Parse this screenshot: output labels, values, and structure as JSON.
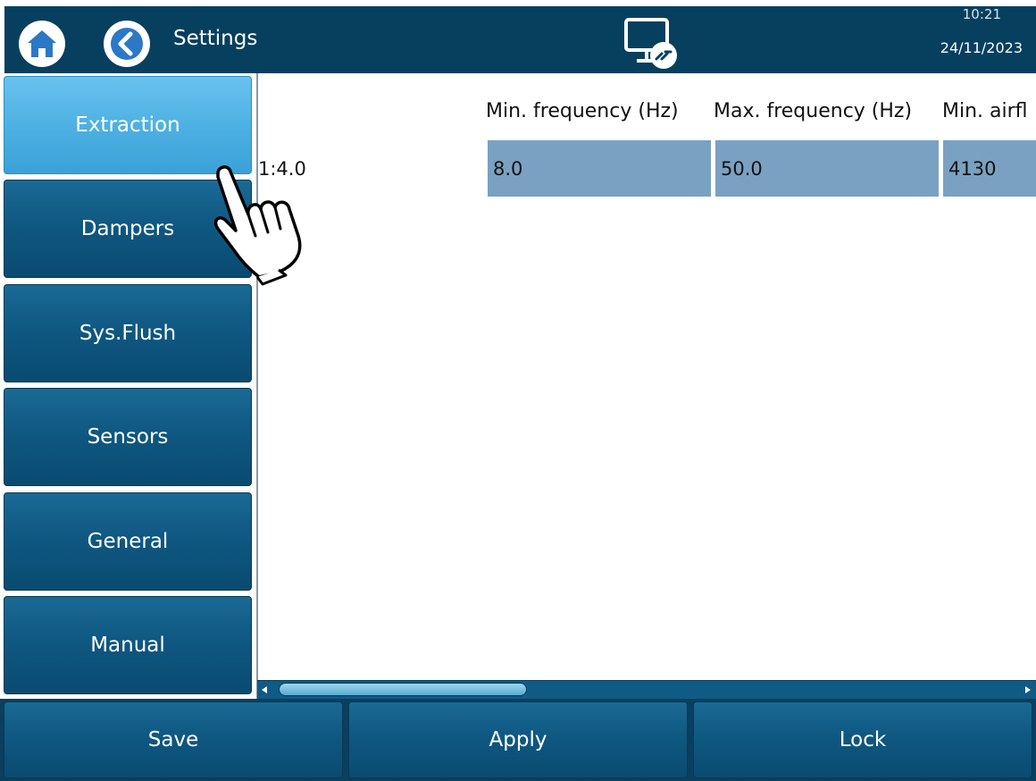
{
  "header": {
    "title": "Settings",
    "time": "10:21",
    "date": "24/11/2023",
    "home_icon": "home-icon",
    "back_icon": "chevron-left-icon",
    "remote_icon": "remote-desktop-icon"
  },
  "nav": {
    "items": [
      {
        "label": "Extraction",
        "active": true
      },
      {
        "label": "Dampers",
        "active": false
      },
      {
        "label": "Sys.Flush",
        "active": false
      },
      {
        "label": "Sensors",
        "active": false
      },
      {
        "label": "General",
        "active": false
      },
      {
        "label": "Manual",
        "active": false
      }
    ]
  },
  "table": {
    "headers": [
      "Min. frequency (Hz)",
      "Max. frequency (Hz)",
      "Min. airfl"
    ],
    "rows": [
      {
        "label": "1:4.0",
        "cells": [
          "8.0",
          "50.0",
          "4130"
        ]
      }
    ]
  },
  "footer": {
    "save_label": "Save",
    "apply_label": "Apply",
    "lock_label": "Lock"
  },
  "colors": {
    "header_bg": "#073f5f",
    "nav_active": "#4eb1e3",
    "nav_button": "#0f5882",
    "cell_bg": "#7aa1c2"
  },
  "cursor_icon": "hand-pointer-icon"
}
